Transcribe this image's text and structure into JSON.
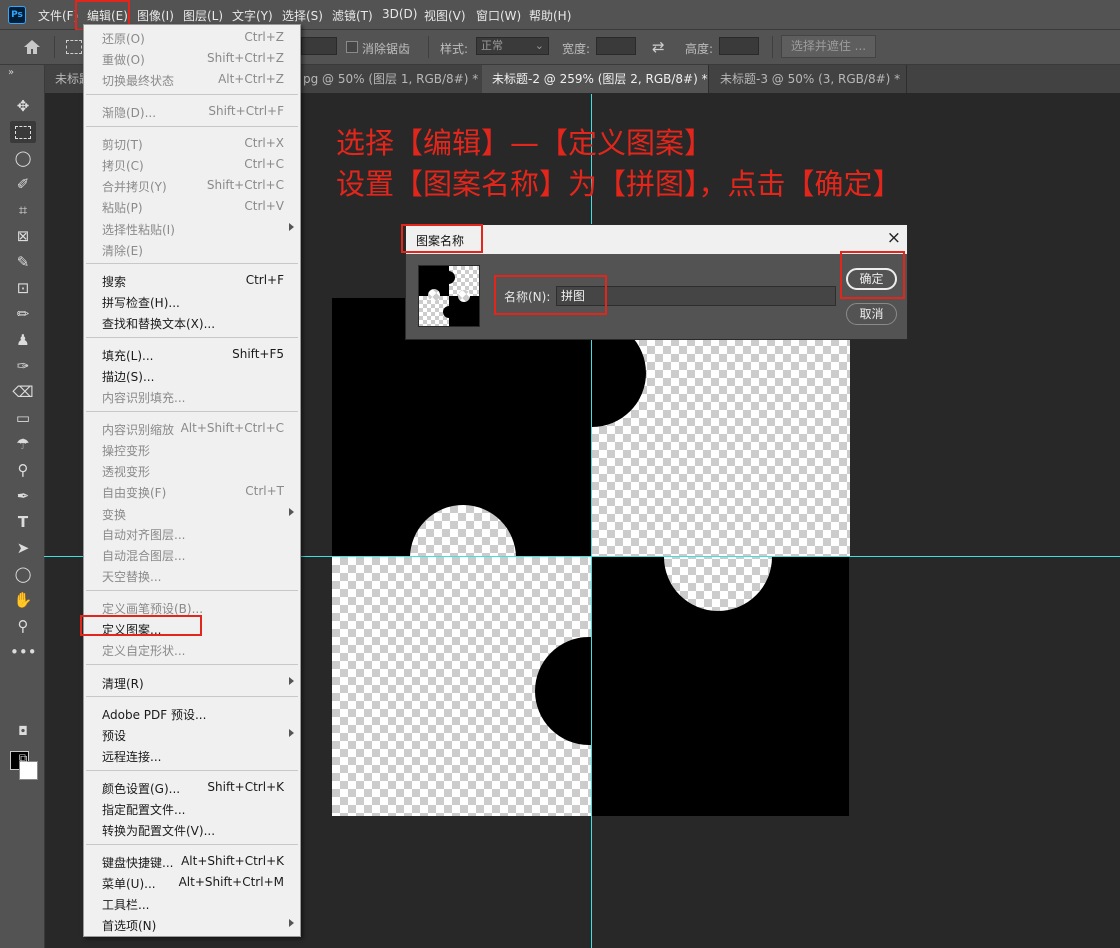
{
  "menubar": {
    "logo": "Ps",
    "items": [
      "文件(F)",
      "编辑(E)",
      "图像(I)",
      "图层(L)",
      "文字(Y)",
      "选择(S)",
      "滤镜(T)",
      "3D(D)",
      "视图(V)",
      "窗口(W)",
      "帮助(H)"
    ]
  },
  "options": {
    "antialias": "消除锯齿",
    "style_label": "样式:",
    "style_value": "正常",
    "width_label": "宽度:",
    "height_label": "高度:",
    "select_mask": "选择并遮住 ..."
  },
  "tabs": [
    {
      "label": "未标题",
      "close": ""
    },
    {
      "label": "pg @ 50% (图层 1, RGB/8#) *",
      "close": "×"
    },
    {
      "label": "未标题-2 @ 259% (图层 2, RGB/8#) *",
      "close": "×"
    },
    {
      "label": "未标题-3 @ 50% (3, RGB/8#) *",
      "close": "×"
    }
  ],
  "edit_menu": {
    "items": [
      {
        "label": "还原(O)",
        "shortcut": "Ctrl+Z"
      },
      {
        "label": "重做(O)",
        "shortcut": "Shift+Ctrl+Z"
      },
      {
        "label": "切换最终状态",
        "shortcut": "Alt+Ctrl+Z"
      },
      {
        "label": "渐隐(D)...",
        "shortcut": "Shift+Ctrl+F"
      },
      {
        "label": "剪切(T)",
        "shortcut": "Ctrl+X"
      },
      {
        "label": "拷贝(C)",
        "shortcut": "Ctrl+C"
      },
      {
        "label": "合并拷贝(Y)",
        "shortcut": "Shift+Ctrl+C"
      },
      {
        "label": "粘贴(P)",
        "shortcut": "Ctrl+V"
      },
      {
        "label": "选择性粘贴(I)",
        "shortcut": ""
      },
      {
        "label": "清除(E)",
        "shortcut": ""
      },
      {
        "label": "搜索",
        "shortcut": "Ctrl+F"
      },
      {
        "label": "拼写检查(H)...",
        "shortcut": ""
      },
      {
        "label": "查找和替换文本(X)...",
        "shortcut": ""
      },
      {
        "label": "填充(L)...",
        "shortcut": "Shift+F5"
      },
      {
        "label": "描边(S)...",
        "shortcut": ""
      },
      {
        "label": "内容识别填充...",
        "shortcut": ""
      },
      {
        "label": "内容识别缩放",
        "shortcut": "Alt+Shift+Ctrl+C"
      },
      {
        "label": "操控变形",
        "shortcut": ""
      },
      {
        "label": "透视变形",
        "shortcut": ""
      },
      {
        "label": "自由变换(F)",
        "shortcut": "Ctrl+T"
      },
      {
        "label": "变换",
        "shortcut": ""
      },
      {
        "label": "自动对齐图层...",
        "shortcut": ""
      },
      {
        "label": "自动混合图层...",
        "shortcut": ""
      },
      {
        "label": "天空替换...",
        "shortcut": ""
      },
      {
        "label": "定义画笔预设(B)...",
        "shortcut": ""
      },
      {
        "label": "定义图案...",
        "shortcut": ""
      },
      {
        "label": "定义自定形状...",
        "shortcut": ""
      },
      {
        "label": "清理(R)",
        "shortcut": ""
      },
      {
        "label": "Adobe PDF 预设...",
        "shortcut": ""
      },
      {
        "label": "预设",
        "shortcut": ""
      },
      {
        "label": "远程连接...",
        "shortcut": ""
      },
      {
        "label": "颜色设置(G)...",
        "shortcut": "Shift+Ctrl+K"
      },
      {
        "label": "指定配置文件...",
        "shortcut": ""
      },
      {
        "label": "转换为配置文件(V)...",
        "shortcut": ""
      },
      {
        "label": "键盘快捷键...",
        "shortcut": "Alt+Shift+Ctrl+K"
      },
      {
        "label": "菜单(U)...",
        "shortcut": "Alt+Shift+Ctrl+M"
      },
      {
        "label": "工具栏...",
        "shortcut": ""
      },
      {
        "label": "首选项(N)",
        "shortcut": ""
      }
    ]
  },
  "annotation": {
    "line1": "选择【编辑】—【定义图案】",
    "line2": "设置【图案名称】为【拼图】，点击【确定】"
  },
  "dialog": {
    "title": "图案名称",
    "close": "×",
    "name_label": "名称(N):",
    "name_value": "拼图",
    "ok": "确定",
    "cancel": "取消"
  },
  "colors": {
    "annotation_red": "#e3261b",
    "guide_cyan": "#3ee0e0"
  }
}
